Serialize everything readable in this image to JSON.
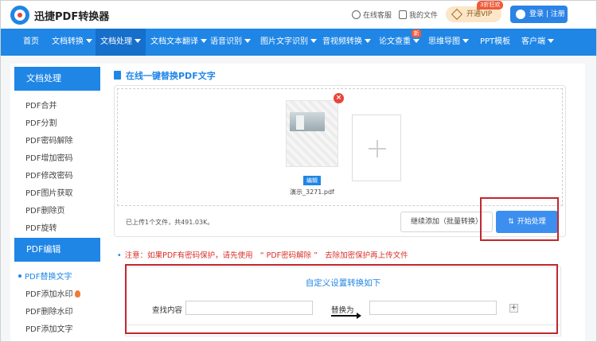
{
  "topbar": {
    "brand": "迅捷PDF转换器",
    "service": "在线客服",
    "my_files": "我的文件",
    "vip_badge": "3折狂欢",
    "vip_label": "开通VIP",
    "login": "登录 | 注册"
  },
  "nav": {
    "items": [
      {
        "label": "首页"
      },
      {
        "label": "文档转换"
      },
      {
        "label": "文档处理"
      },
      {
        "label": "文档文本翻译"
      },
      {
        "label": "语音识别"
      },
      {
        "label": "图片文字识别"
      },
      {
        "label": "音视频转换"
      },
      {
        "label": "论文查重"
      },
      {
        "label": "思维导图"
      },
      {
        "label": "PPT模板"
      },
      {
        "label": "客户端"
      }
    ],
    "new_badge": "新"
  },
  "sidebar": {
    "section1_title": "文档处理",
    "section1_items": [
      "PDF合并",
      "PDF分割",
      "PDF密码解除",
      "PDF增加密码",
      "PDF修改密码",
      "PDF图片获取",
      "PDF删除页",
      "PDF旋转"
    ],
    "section2_title": "PDF编辑",
    "section2_items": [
      "PDF替换文字",
      "PDF添加水印",
      "PDF删除水印",
      "PDF添加文字"
    ]
  },
  "main": {
    "title": "在线一键替换PDF文字",
    "file": {
      "edit_tag": "编辑",
      "name": "演示_3271.pdf"
    },
    "upload_info": "已上传1个文件，共491.03K。",
    "continue_button": "继续添加（批量转换）",
    "start_button": "开始处理",
    "notice_prefix": "注意：如果PDF有密码保护，请先使用",
    "notice_link": "“ PDF密码解除 ”",
    "notice_suffix": "去除加密保护再上传文件",
    "settings": {
      "title": "自定义设置转换如下",
      "find_label": "查找内容",
      "find_value": "",
      "replace_label": "替换为",
      "replace_value": "",
      "add_row": "+"
    }
  },
  "colors": {
    "accent": "#1f86e6",
    "highlight": "#c1272d",
    "warning": "#d9302a"
  }
}
